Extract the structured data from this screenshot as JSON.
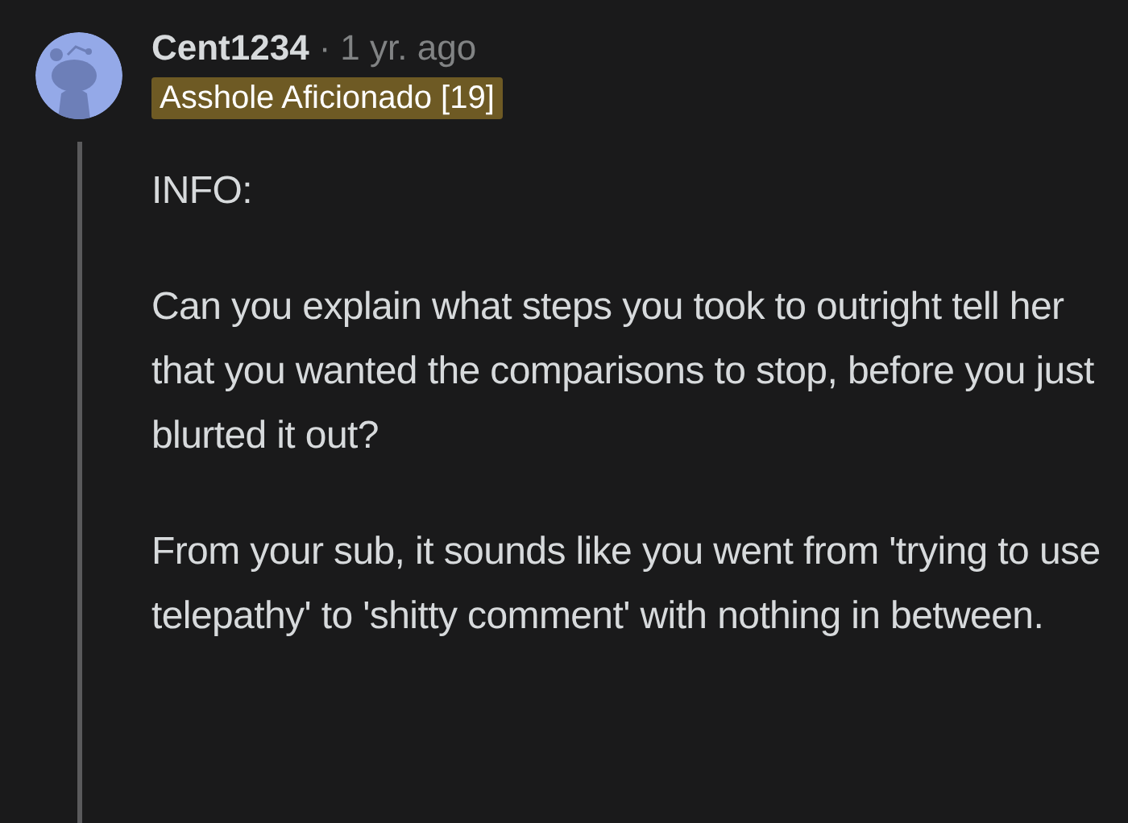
{
  "comment": {
    "author": "Cent1234",
    "separator": "·",
    "time": "1 yr. ago",
    "flair": "Asshole Aficionado [19]",
    "paragraphs": [
      "INFO:",
      "Can you explain what steps you took to outright tell her that you wanted the comparisons to stop, before you just blurted it out?",
      "From your sub, it sounds like you went from 'trying to use telepathy' to 'shitty comment' with nothing in between."
    ]
  }
}
